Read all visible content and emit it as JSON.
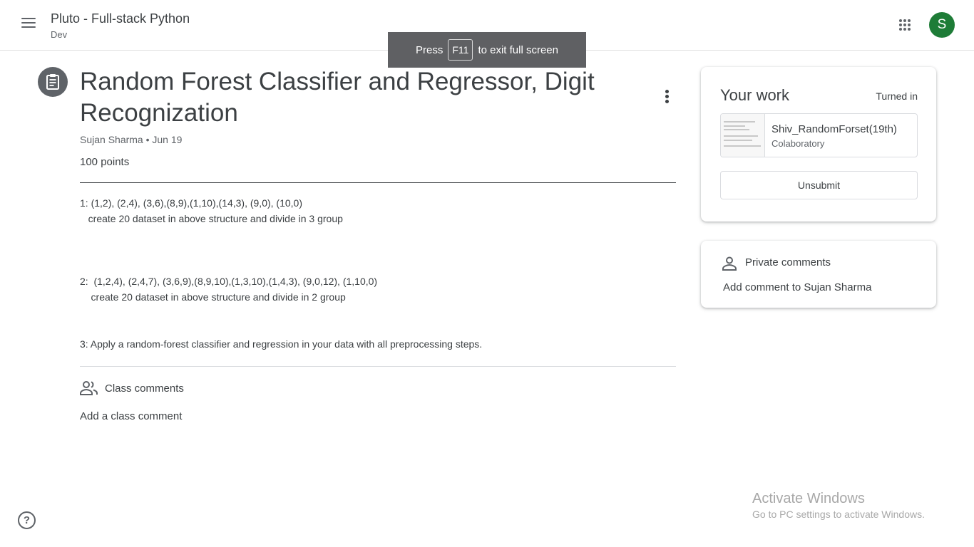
{
  "header": {
    "class_title": "Pluto - Full-stack Python",
    "class_section": "Dev",
    "avatar_letter": "S",
    "avatar_color": "#1e7c37"
  },
  "fullscreen_toast": {
    "press": "Press",
    "key": "F11",
    "suffix": "to exit full screen"
  },
  "assignment": {
    "title": "Random Forest Classifier and Regressor, Digit Recognization",
    "meta": "Sujan Sharma • Jun 19",
    "points": "100 points",
    "description": [
      "1: (1,2), (2,4), (3,6),(8,9),(1,10),(14,3), (9,0), (10,0)",
      "   create 20 dataset in above structure and divide in 3 group",
      "2:  (1,2,4), (2,4,7), (3,6,9),(8,9,10),(1,3,10),(1,4,3), (9,0,12), (1,10,0)",
      "    create 20 dataset in above structure and divide in 2 group",
      "3: Apply a random-forest classifier and regression in your data with all preprocessing steps."
    ]
  },
  "class_comments": {
    "label": "Class comments",
    "add": "Add a class comment"
  },
  "your_work": {
    "title": "Your work",
    "status": "Turned in",
    "attachment_name": "Shiv_RandomForset(19th)",
    "attachment_type": "Colaboratory",
    "unsubmit": "Unsubmit"
  },
  "private_comments": {
    "label": "Private comments",
    "add": "Add comment to Sujan Sharma"
  },
  "windows_watermark": {
    "title": "Activate Windows",
    "subtitle": "Go to PC settings to activate Windows."
  },
  "help": "?",
  "icons": [
    "menu-icon",
    "apps-icon",
    "assignment-icon",
    "more-vert-icon",
    "people-icon",
    "person-icon",
    "help-icon"
  ]
}
